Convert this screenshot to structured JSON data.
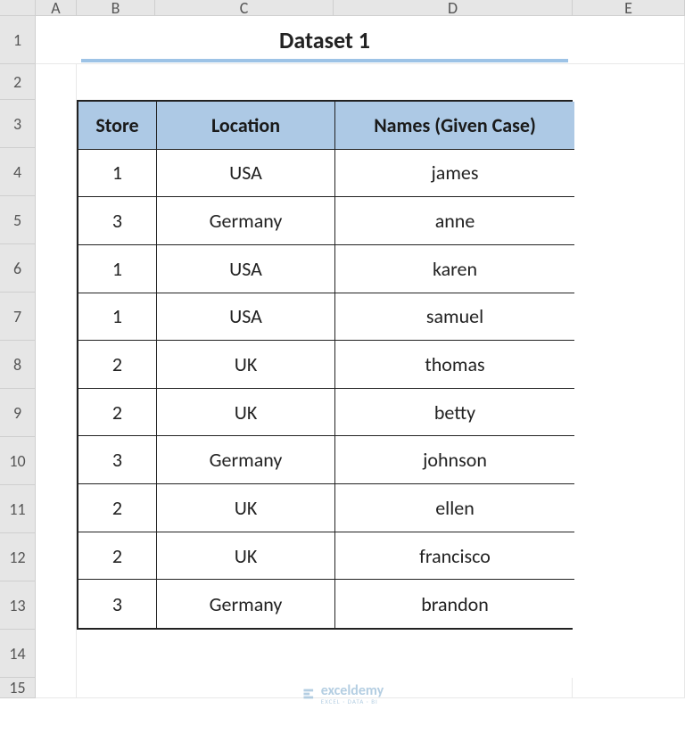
{
  "colHeaders": [
    "A",
    "B",
    "C",
    "D",
    "E"
  ],
  "rowHeaders": [
    "1",
    "2",
    "3",
    "4",
    "5",
    "6",
    "7",
    "8",
    "9",
    "10",
    "11",
    "12",
    "13",
    "14",
    "15"
  ],
  "title": "Dataset 1",
  "headers": {
    "c0": "Store",
    "c1": "Location",
    "c2": "Names (Given Case)"
  },
  "rows": [
    {
      "c0": "1",
      "c1": "USA",
      "c2": "james"
    },
    {
      "c0": "3",
      "c1": "Germany",
      "c2": "anne"
    },
    {
      "c0": "1",
      "c1": "USA",
      "c2": "karen"
    },
    {
      "c0": "1",
      "c1": "USA",
      "c2": "samuel"
    },
    {
      "c0": "2",
      "c1": "UK",
      "c2": "thomas"
    },
    {
      "c0": "2",
      "c1": "UK",
      "c2": "betty"
    },
    {
      "c0": "3",
      "c1": "Germany",
      "c2": "johnson"
    },
    {
      "c0": "2",
      "c1": "UK",
      "c2": "ellen"
    },
    {
      "c0": "2",
      "c1": "UK",
      "c2": "francisco"
    },
    {
      "c0": "3",
      "c1": "Germany",
      "c2": "brandon"
    }
  ],
  "watermark": {
    "name": "exceldemy",
    "sub": "EXCEL · DATA · BI"
  }
}
